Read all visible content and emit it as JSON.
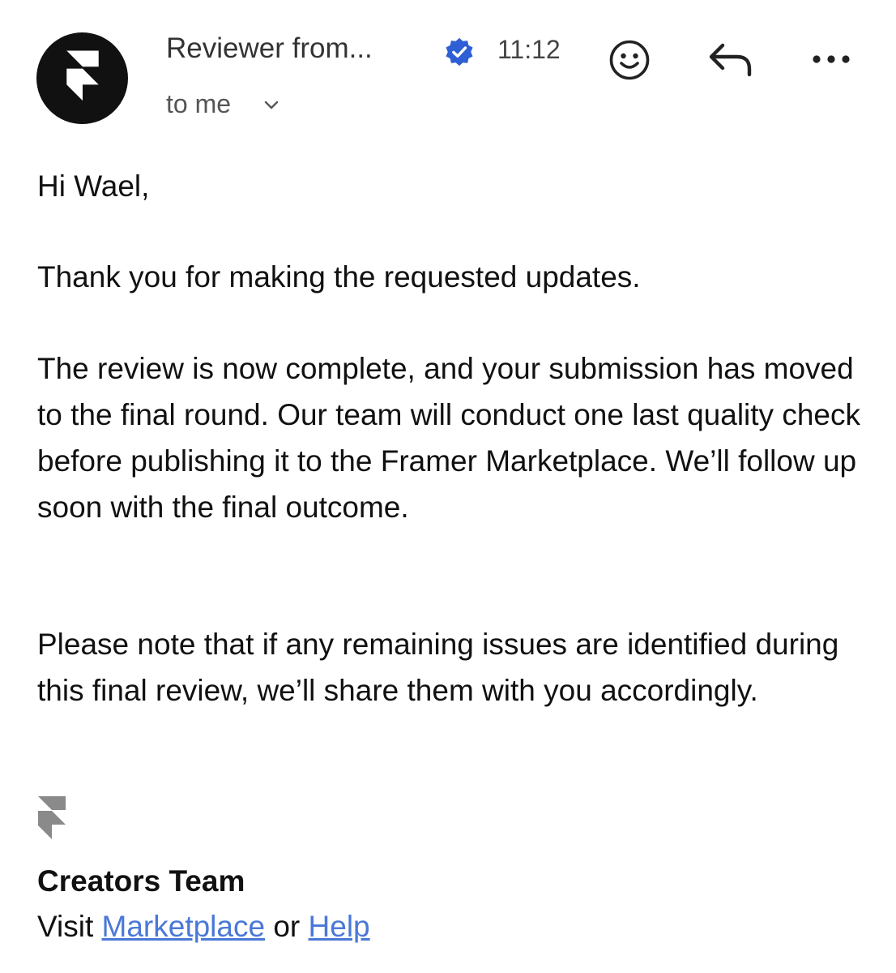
{
  "header": {
    "sender_name": "Reviewer from...",
    "time": "11:12",
    "recipient_label": "to me",
    "icons": {
      "avatar": "framer-logo-icon",
      "verified": "verified-badge-icon",
      "details_toggle": "chevron-down-icon",
      "emoji": "emoji-reaction-icon",
      "reply": "reply-icon",
      "more": "more-options-icon"
    }
  },
  "message": {
    "greeting": "Hi Wael,",
    "paragraphs": [
      "Thank you for making the requested updates.",
      "The review is now complete, and your submission has moved to the final round. Our team will conduct one last quality check before publishing it to the Framer Marketplace. We’ll follow up soon with the final outcome.",
      "Please note that if any remaining issues are identified during this final review, we’ll share them with you accordingly."
    ]
  },
  "signature": {
    "logo_icon": "framer-logo-icon",
    "team_name": "Creators Team",
    "visit_label": "Visit",
    "marketplace_link": "Marketplace",
    "or_label": "or",
    "help_link": "Help"
  },
  "colors": {
    "text": "#111111",
    "muted": "#555555",
    "link": "#4a78d6",
    "verified_badge": "#2f5fd4",
    "avatar_bg": "#111111",
    "signature_logo": "#8a8a8a"
  }
}
